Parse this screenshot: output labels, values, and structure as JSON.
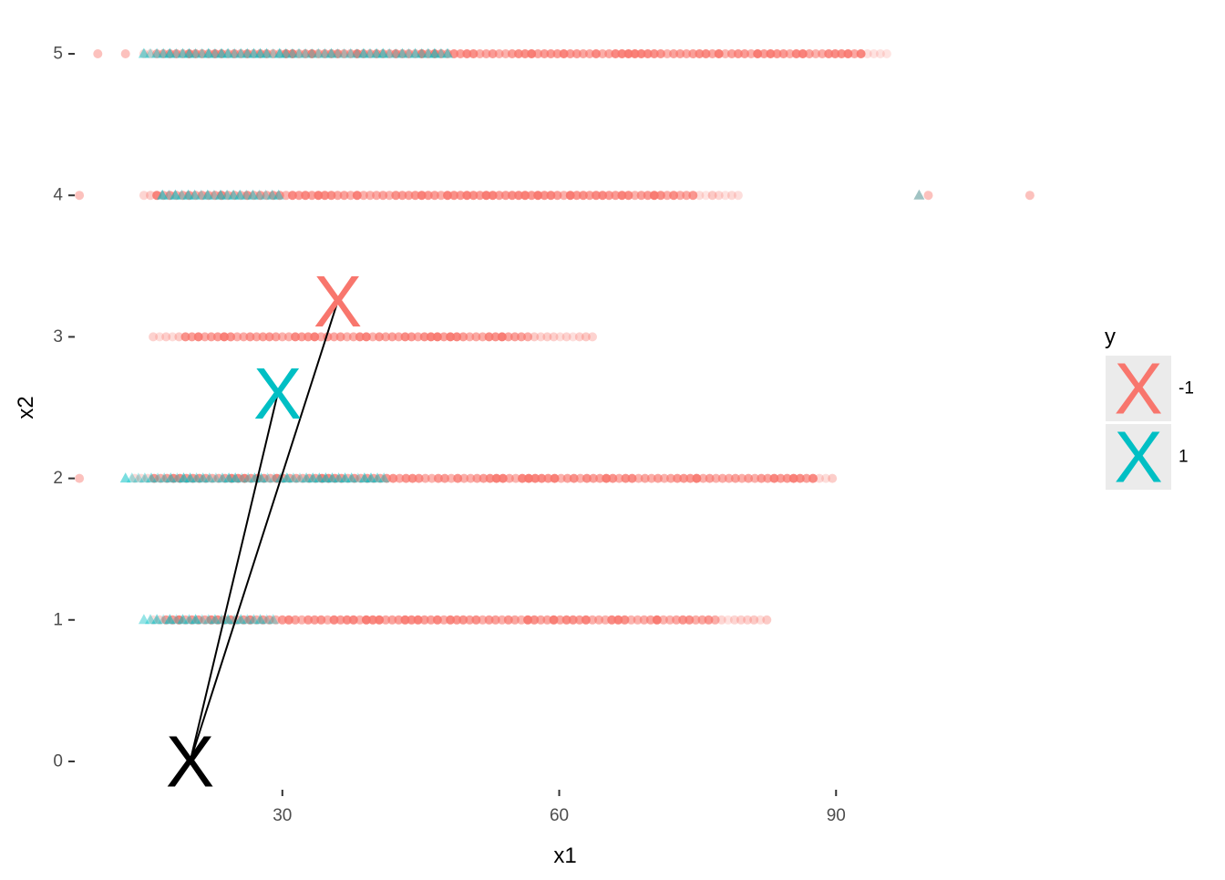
{
  "chart_data": {
    "type": "scatter",
    "xlabel": "x1",
    "ylabel": "x2",
    "xlim": [
      7.5,
      112
    ],
    "ylim": [
      -0.2,
      5.2
    ],
    "x_ticks": [
      30,
      60,
      90
    ],
    "y_ticks": [
      0,
      1,
      2,
      3,
      4,
      5
    ],
    "grid": false,
    "legend": {
      "title": "y",
      "placement": "right",
      "entries": [
        {
          "label": "-1",
          "color": "#F8766D",
          "symbol": "X"
        },
        {
          "label": "1",
          "color": "#00BFC4",
          "symbol": "X"
        }
      ]
    },
    "series": [
      {
        "name": "-1",
        "color": "#F8766D",
        "marker": "circle",
        "rows": [
          {
            "y": 5,
            "x_min": 15,
            "x_max": 96,
            "dense_from": 16,
            "dense_to": 93,
            "isolated": [
              10,
              13
            ]
          },
          {
            "y": 4,
            "x_min": 15,
            "x_max": 80,
            "dense_from": 16,
            "dense_to": 75,
            "isolated": [
              8,
              100,
              111
            ]
          },
          {
            "y": 3,
            "x_min": 16,
            "x_max": 64,
            "dense_from": 19,
            "dense_to": 57,
            "isolated": []
          },
          {
            "y": 2,
            "x_min": 14,
            "x_max": 90,
            "dense_from": 16,
            "dense_to": 88,
            "isolated": [
              8
            ]
          },
          {
            "y": 1,
            "x_min": 16,
            "x_max": 83,
            "dense_from": 17,
            "dense_to": 77,
            "isolated": []
          }
        ]
      },
      {
        "name": "1",
        "color": "#00BFC4",
        "marker": "triangle",
        "rows": [
          {
            "y": 5,
            "x_min": 15,
            "x_max": 48,
            "isolated": []
          },
          {
            "y": 4,
            "x_min": 17,
            "x_max": 30,
            "isolated": [
              99
            ]
          },
          {
            "y": 2,
            "x_min": 13,
            "x_max": 41,
            "isolated": []
          },
          {
            "y": 1,
            "x_min": 15,
            "x_max": 29,
            "isolated": []
          }
        ]
      }
    ],
    "markers": [
      {
        "label": "X",
        "color": "#F8766D",
        "x": 36,
        "y": 3.25
      },
      {
        "label": "X",
        "color": "#00BFC4",
        "x": 29.5,
        "y": 2.6
      },
      {
        "label": "X",
        "color": "#000000",
        "x": 20,
        "y": 0
      }
    ],
    "arrows": [
      {
        "from": [
          20,
          0
        ],
        "to": [
          36,
          3.25
        ],
        "color": "#000000"
      },
      {
        "from": [
          20,
          0
        ],
        "to": [
          29.5,
          2.6
        ],
        "color": "#000000"
      }
    ]
  }
}
